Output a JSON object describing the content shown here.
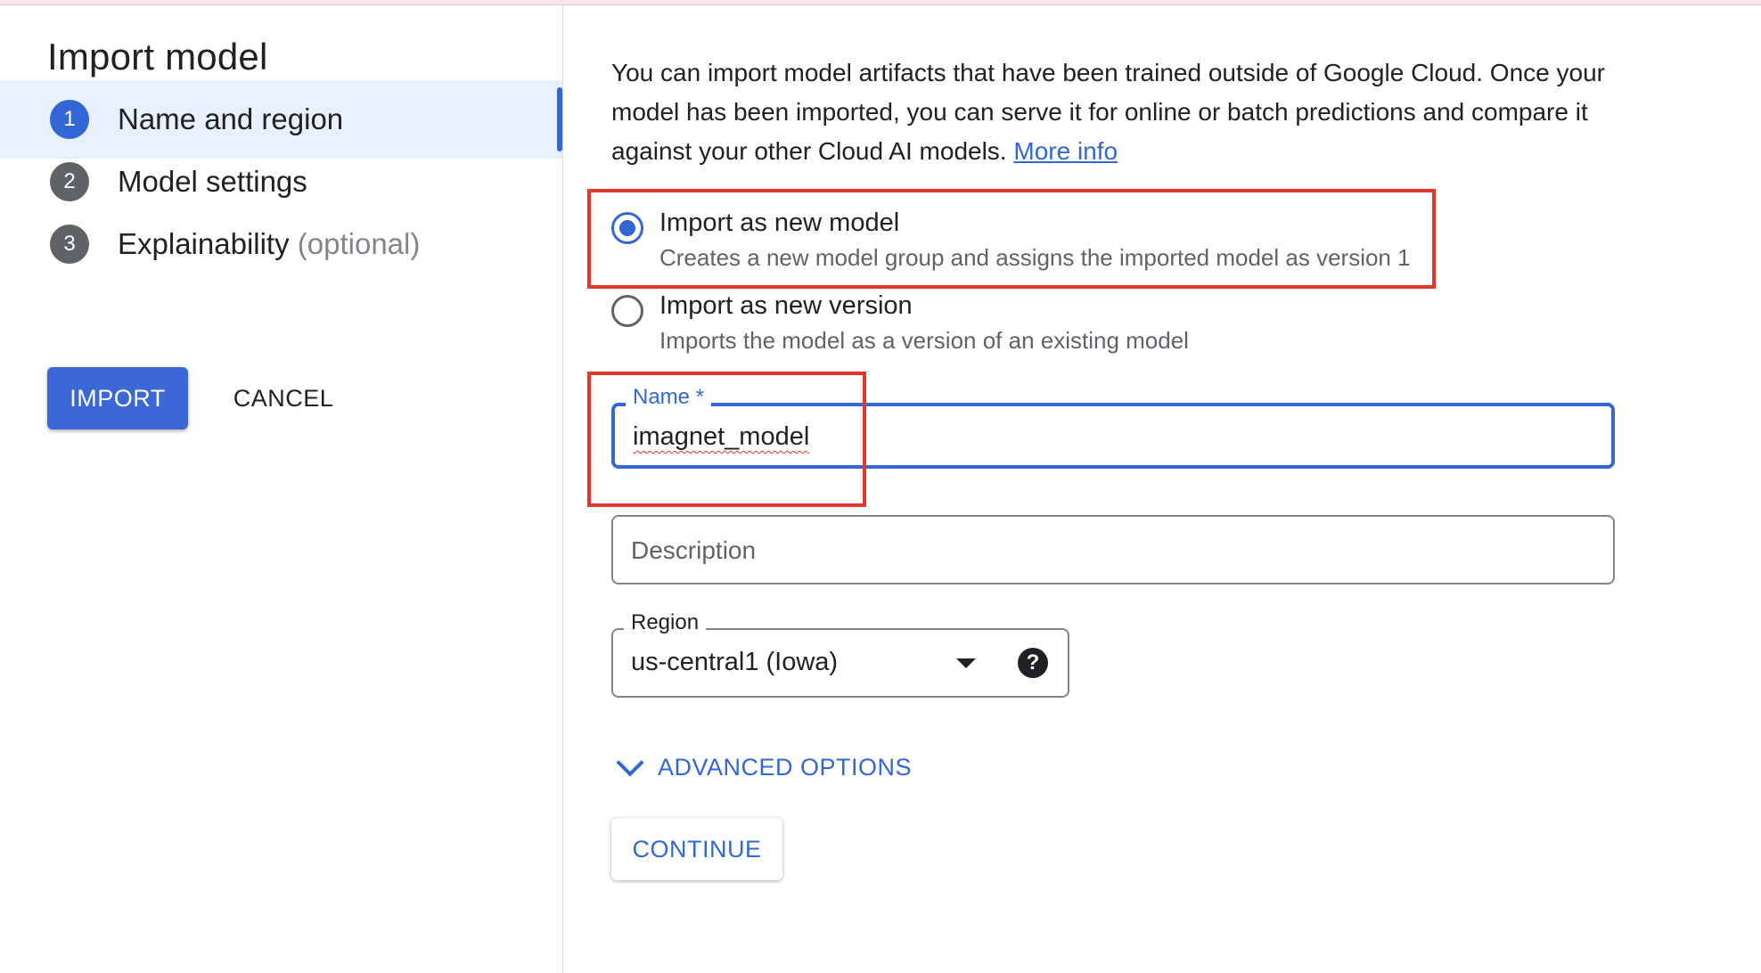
{
  "left": {
    "title": "Import model",
    "steps": [
      {
        "num": "1",
        "label": "Name and region",
        "optional": ""
      },
      {
        "num": "2",
        "label": "Model settings",
        "optional": ""
      },
      {
        "num": "3",
        "label": "Explainability",
        "optional": "(optional)"
      }
    ],
    "import_label": "IMPORT",
    "cancel_label": "CANCEL"
  },
  "main": {
    "intro_text": "You can import model artifacts that have been trained outside of Google Cloud. Once your model has been imported, you can serve it for online or batch predictions and compare it against your other Cloud AI models.",
    "more_info": "More info",
    "options": [
      {
        "title": "Import as new model",
        "subtitle": "Creates a new model group and assigns the imported model as version 1",
        "selected": true
      },
      {
        "title": "Import as new version",
        "subtitle": "Imports the model as a version of an existing model",
        "selected": false
      }
    ],
    "name_field": {
      "label": "Name *",
      "value": "imagnet_model"
    },
    "description_field": {
      "placeholder": "Description"
    },
    "region_field": {
      "label": "Region",
      "value": "us-central1 (Iowa)"
    },
    "advanced_label": "ADVANCED OPTIONS",
    "continue_label": "CONTINUE"
  },
  "colors": {
    "accent": "#3367d6",
    "highlight": "#e0392b",
    "active_step_bg": "#e8f0fe"
  },
  "icons": {
    "help": "help-circle-icon",
    "dropdown": "arrow-drop-down-icon",
    "expand": "chevron-down-icon"
  }
}
